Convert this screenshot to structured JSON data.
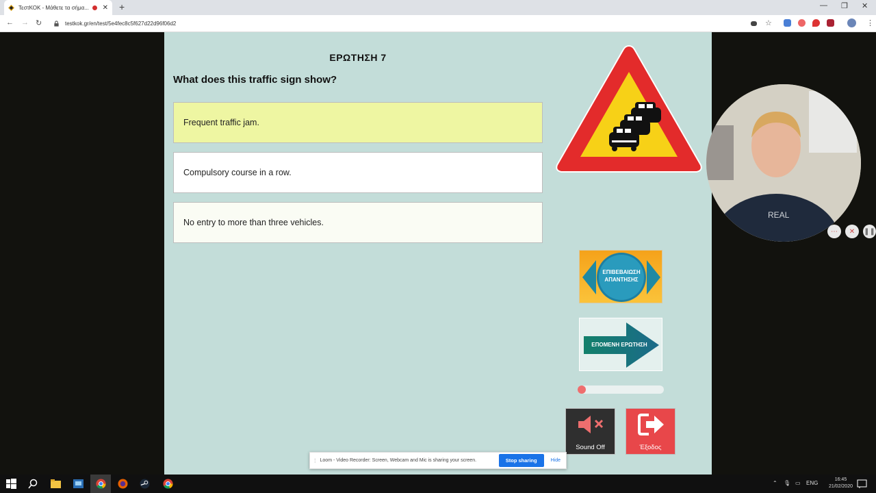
{
  "browser": {
    "tab_title": "ΤεστΚΟΚ - Μάθετε τα σήμα...",
    "url": "testkok.gr/en/test/5e4fec8c5f627d22d96f06d2"
  },
  "quiz": {
    "question_number_label": "ΕΡΩΤΗΣΗ 7",
    "question_text": "What does this traffic sign show?",
    "answers": [
      {
        "text": "Frequent traffic jam.",
        "selected": true
      },
      {
        "text": "Compulsory course in a row.",
        "selected": false
      },
      {
        "text": "No entry to more than three vehicles.",
        "selected": false
      }
    ],
    "confirm_button": {
      "line1": "ΕΠΙΒΕΒΑΙΩΣΗ",
      "line2": "ΑΠΑΝΤΗΣΗΣ"
    },
    "next_button": {
      "label": "ΕΠΟΜΕΝΗ  ΕΡΩΤΗΣΗ"
    },
    "progress_fraction": 0.05,
    "sound_button_label": "Sound Off",
    "exit_button_label": "Έξοδος"
  },
  "loom_bar": {
    "message": "Loom - Video Recorder: Screen, Webcam and Mic is sharing your screen.",
    "stop_label": "Stop sharing",
    "hide_label": "Hide"
  },
  "taskbar": {
    "language": "ENG",
    "time": "16:45",
    "date": "21/02/2020"
  },
  "colors": {
    "page_bg": "#c3ddd9",
    "selected_answer": "#eef6a2",
    "sign_red": "#e32b2b",
    "sign_yellow": "#f7d117",
    "exit_red": "#e8474a",
    "loom_blue": "#1a73e8"
  }
}
